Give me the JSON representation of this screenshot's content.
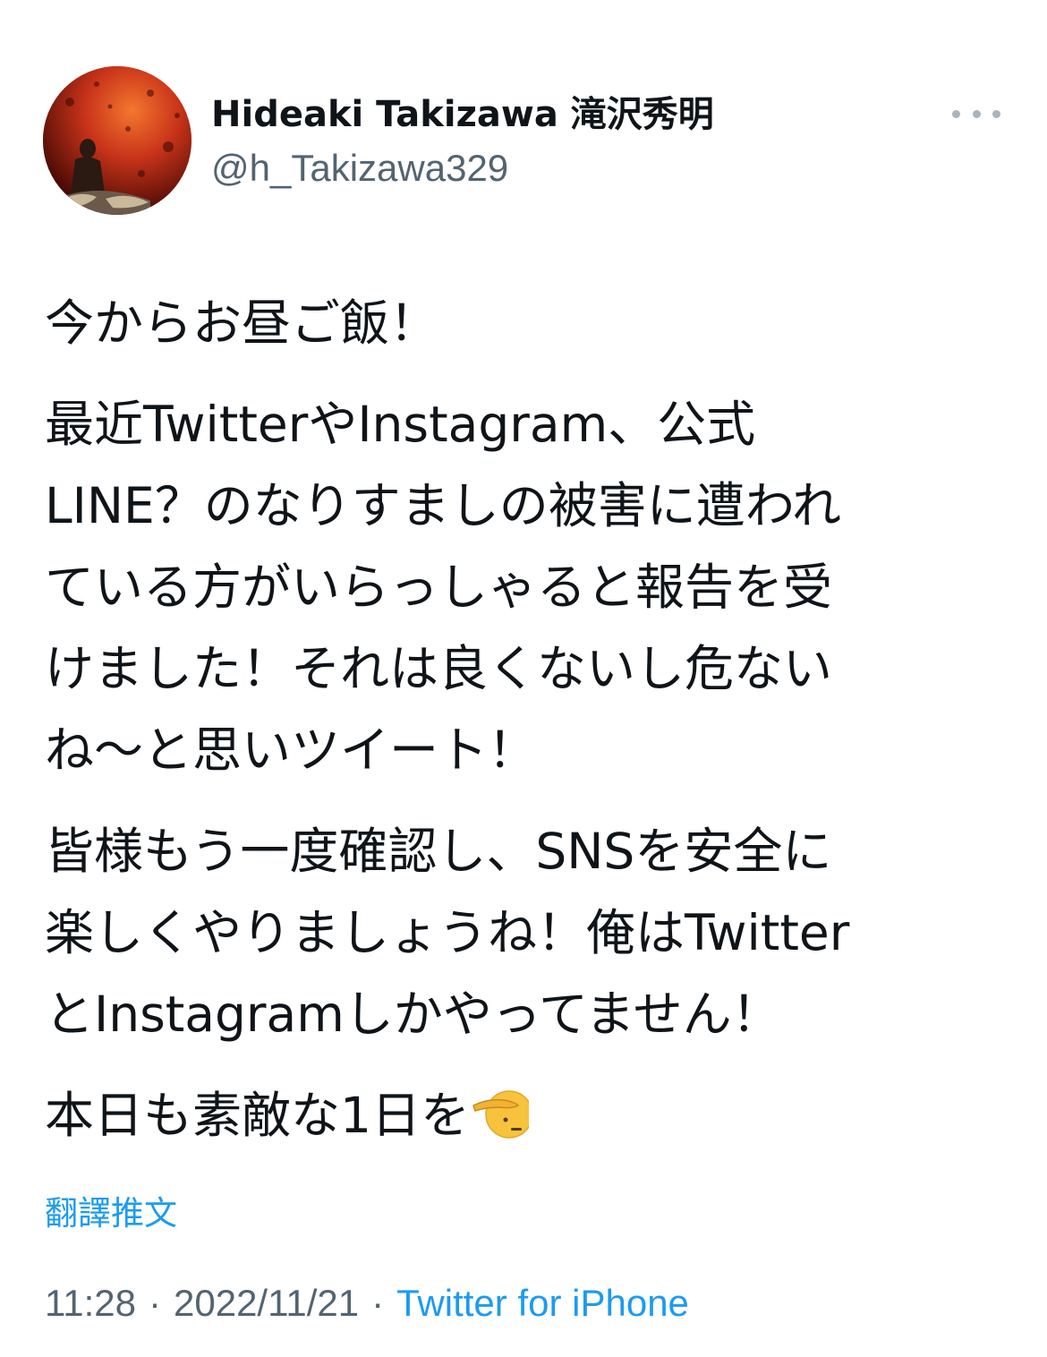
{
  "author": {
    "name": "Hideaki Takizawa 滝沢秀明",
    "handle": "@h_Takizawa329"
  },
  "more_icon": "more-horizontal-icon",
  "tweet": {
    "paragraphs": [
      "今からお昼ご飯！",
      "最近TwitterやInstagram、公式\nLINE？のなりすましの被害に遭われ\nている方がいらっしゃると報告を受\nけました！それは良くないし危ない\nね〜と思いツイート！",
      "皆様もう一度確認し、SNSを安全に\n楽しくやりましょうね！俺はTwitter\nとInstagramしかやってません！",
      "本日も素敵な1日を"
    ],
    "emoji": "saluting-face-emoji"
  },
  "translate_label": "翻譯推文",
  "meta": {
    "time": "11:28",
    "separator": "·",
    "date": "2022/11/21",
    "source": "Twitter for iPhone"
  },
  "colors": {
    "link": "#1d9bf0",
    "secondary_text": "#536471",
    "primary_text": "#0f1419"
  }
}
